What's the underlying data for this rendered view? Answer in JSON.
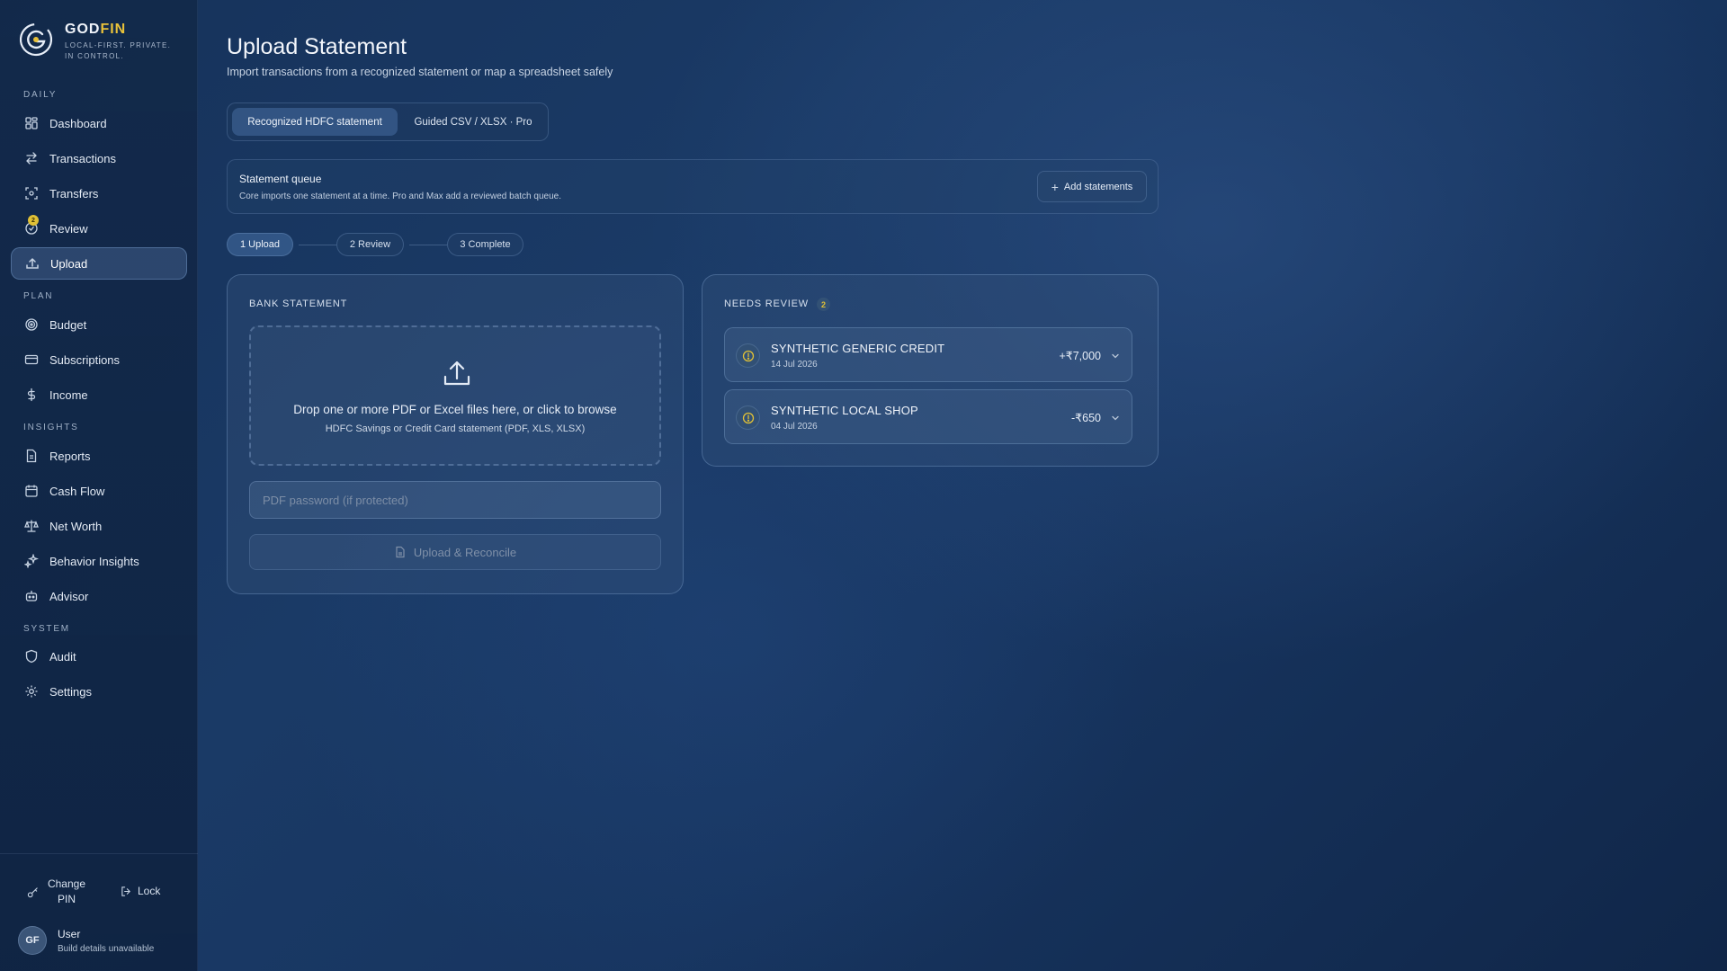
{
  "brand": {
    "name_main": "GOD",
    "name_accent": "FIN",
    "tagline": "LOCAL-FIRST. PRIVATE. IN CONTROL."
  },
  "nav": {
    "sections": {
      "daily": "DAILY",
      "plan": "PLAN",
      "insights": "INSIGHTS",
      "system": "SYSTEM"
    },
    "items": [
      {
        "label": "Dashboard",
        "icon": "grid-icon"
      },
      {
        "label": "Transactions",
        "icon": "swap-icon"
      },
      {
        "label": "Transfers",
        "icon": "transfer-icon"
      },
      {
        "label": "Review",
        "icon": "review-icon"
      },
      {
        "label": "Upload",
        "icon": "upload-icon",
        "active": true
      },
      {
        "label": "Budget",
        "icon": "target-icon"
      },
      {
        "label": "Subscriptions",
        "icon": "card-icon"
      },
      {
        "label": "Income",
        "icon": "dollar-icon"
      },
      {
        "label": "Reports",
        "icon": "document-icon"
      },
      {
        "label": "Cash Flow",
        "icon": "calendar-icon"
      },
      {
        "label": "Net Worth",
        "icon": "scale-icon"
      },
      {
        "label": "Behavior Insights",
        "icon": "sparkle-icon"
      },
      {
        "label": "Advisor",
        "icon": "bot-icon"
      },
      {
        "label": "Audit",
        "icon": "shield-icon"
      },
      {
        "label": "Settings",
        "icon": "gear-icon"
      }
    ],
    "review_badge": "2"
  },
  "footer": {
    "change_pin": "Change PIN",
    "lock": "Lock",
    "avatar": "GF",
    "user_name": "User",
    "user_sub": "Build details unavailable"
  },
  "page": {
    "title": "Upload Statement",
    "subtitle": "Import transactions from a recognized statement or map a spreadsheet safely"
  },
  "mode_tabs": {
    "recognized": "Recognized HDFC statement",
    "guided": "Guided CSV / XLSX · Pro"
  },
  "queue": {
    "title": "Statement queue",
    "description": "Core imports one statement at a time. Pro and Max add a reviewed batch queue.",
    "add_label": "Add statements"
  },
  "steps": [
    "1  Upload",
    "2  Review",
    "3  Complete"
  ],
  "upload_card": {
    "label": "BANK STATEMENT",
    "drop_main": "Drop one or more PDF or Excel files here, or click to browse",
    "drop_sub": "HDFC Savings or Credit Card statement (PDF, XLS, XLSX)",
    "password_placeholder": "PDF password (if protected)",
    "upload_label": "Upload & Reconcile"
  },
  "review_card": {
    "label": "NEEDS REVIEW",
    "count": "2",
    "items": [
      {
        "name": "SYNTHETIC GENERIC CREDIT",
        "date": "14 Jul 2026",
        "amount": "+₹7,000"
      },
      {
        "name": "SYNTHETIC LOCAL SHOP",
        "date": "04 Jul 2026",
        "amount": "-₹650"
      }
    ]
  },
  "colors": {
    "accent": "#e8c13a",
    "background": "#16325a"
  }
}
